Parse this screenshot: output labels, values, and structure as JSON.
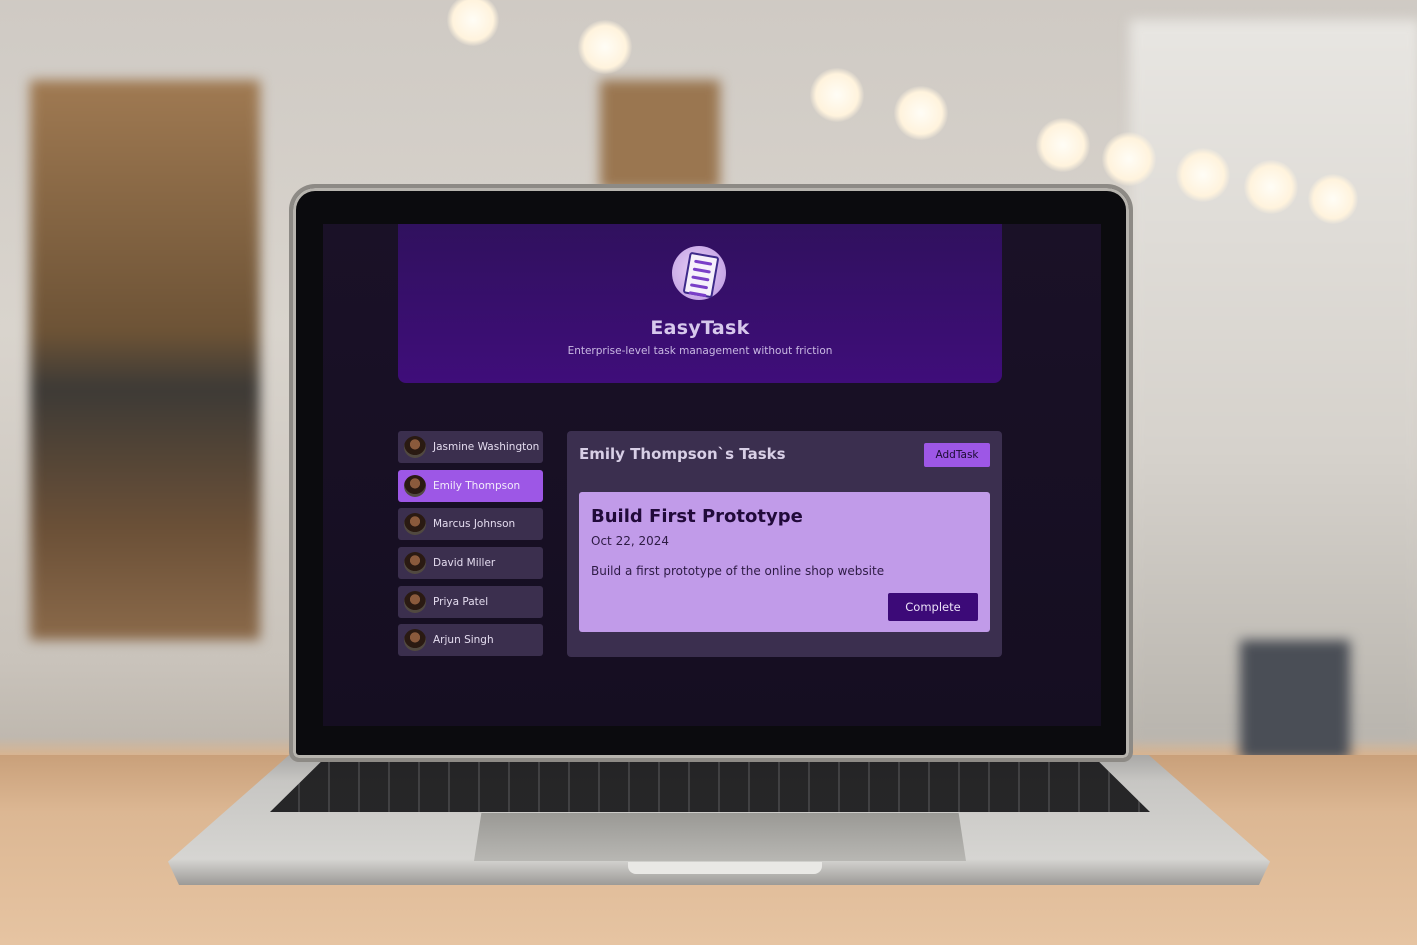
{
  "app": {
    "title": "EasyTask",
    "subtitle": "Enterprise-level task management without friction",
    "logo_icon": "clipboard-checklist-icon"
  },
  "users": [
    {
      "name": "Jasmine Washington",
      "selected": false
    },
    {
      "name": "Emily Thompson",
      "selected": true
    },
    {
      "name": "Marcus Johnson",
      "selected": false
    },
    {
      "name": "David Miller",
      "selected": false
    },
    {
      "name": "Priya Patel",
      "selected": false
    },
    {
      "name": "Arjun Singh",
      "selected": false
    }
  ],
  "tasks_panel": {
    "title": "Emily Thompson`s Tasks",
    "add_button_label": "AddTask"
  },
  "tasks": [
    {
      "title": "Build First Prototype",
      "date": "Oct 22, 2024",
      "description": "Build a first prototype of the online shop website",
      "complete_label": "Complete"
    }
  ],
  "colors": {
    "accent": "#9d57e6",
    "header": "#3f0d7a",
    "card": "#c19be9",
    "button_dark": "#3c0a78",
    "screen_bg": "#1a1127"
  }
}
